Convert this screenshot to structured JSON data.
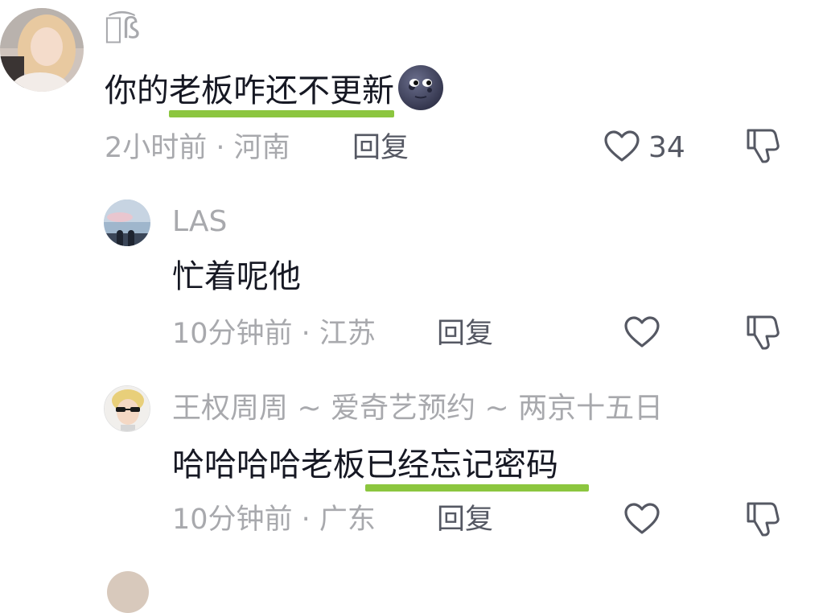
{
  "comments": [
    {
      "username": "ย͡ß",
      "content_prefix": "你的",
      "content_highlight": "老板咋还不更新",
      "emoji": "new-moon-face",
      "time_location": "2小时前 · 河南",
      "reply_label": "回复",
      "like_count": "34"
    }
  ],
  "replies": [
    {
      "username": "LAS",
      "content": "忙着呢他",
      "time_location": "10分钟前 · 江苏",
      "reply_label": "回复"
    },
    {
      "username": "王权周周 ~ 爱奇艺预约 ~ 两京十五日",
      "content_prefix": "哈哈哈哈老板",
      "content_highlight": "已经忘记密码",
      "time_location": "10分钟前 · 广东",
      "reply_label": "回复"
    }
  ],
  "colors": {
    "highlight": "#8cc63f",
    "secondary_text": "#a8a9ad",
    "primary_text": "#161823",
    "action_text": "#555863"
  }
}
